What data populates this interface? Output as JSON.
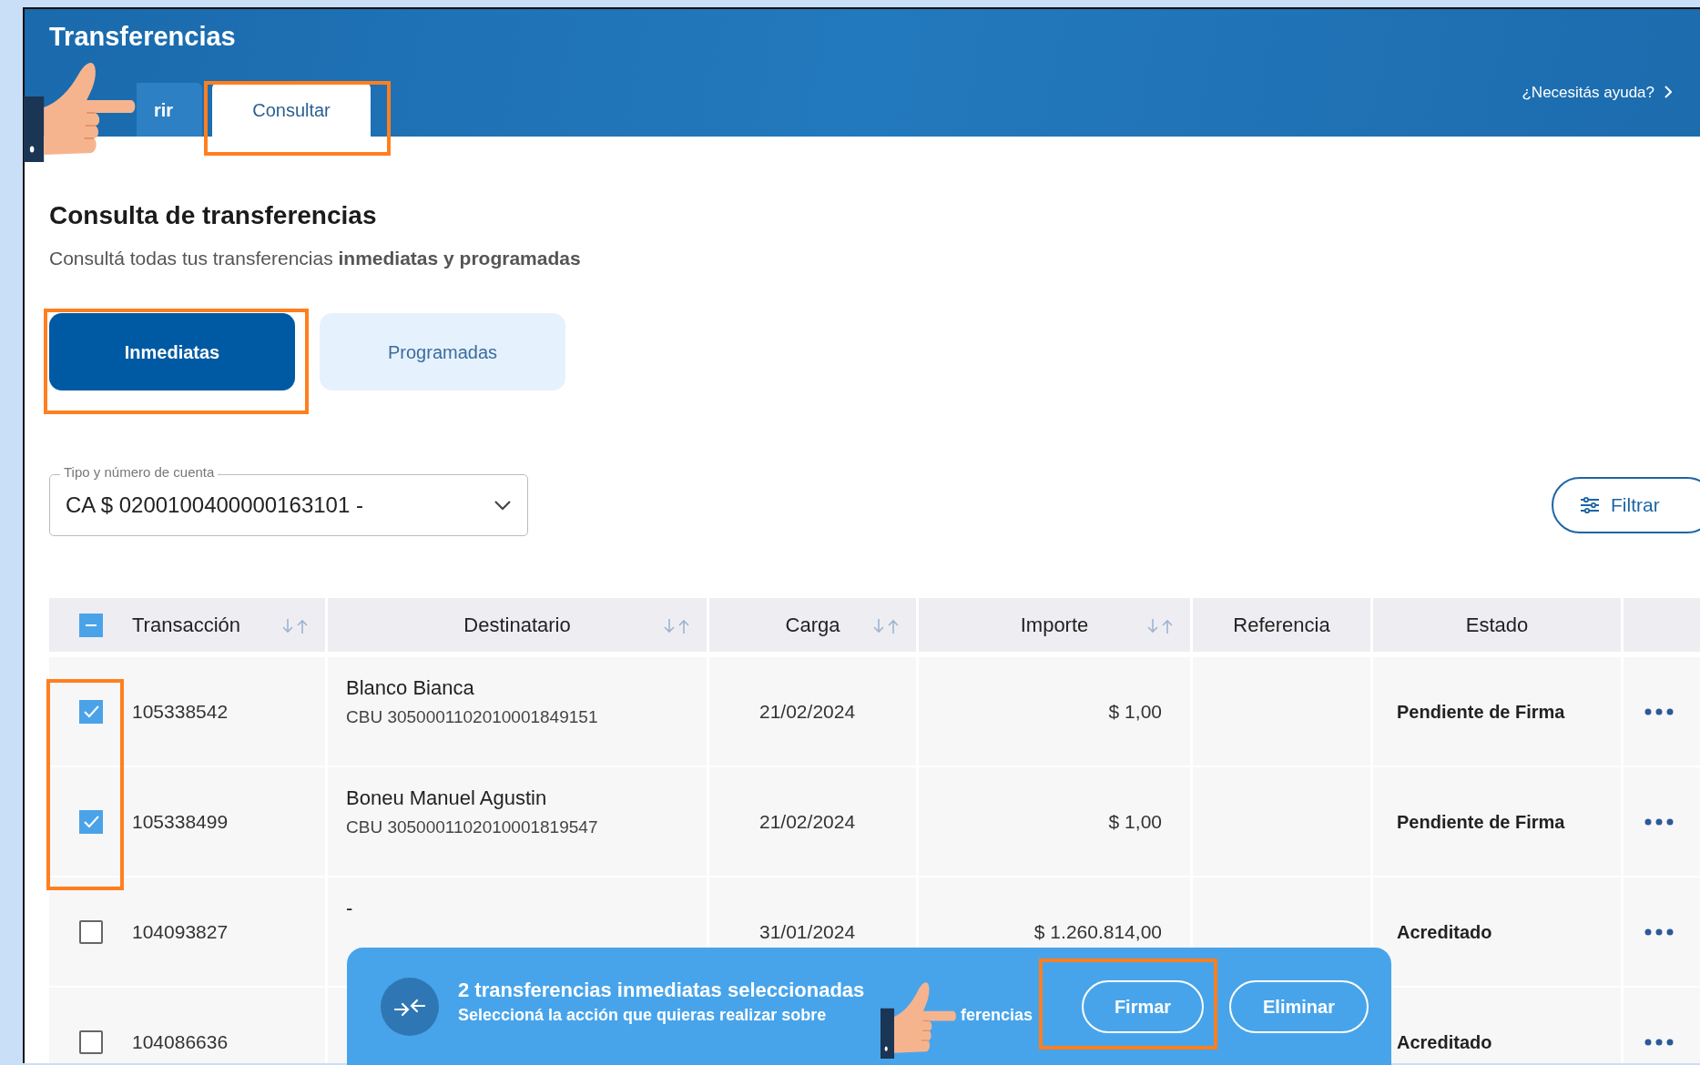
{
  "header": {
    "title": "Transferencias",
    "tabs": [
      {
        "label": "rir",
        "selected": false
      },
      {
        "label": "Consultar",
        "selected": true
      }
    ],
    "help_link": "¿Necesitás ayuda?"
  },
  "heading": "Consulta de transferencias",
  "subtitle": "Consultá todas tus transferencias **inmediatas y programadas**",
  "segments": [
    {
      "label": "Inmediatas",
      "selected": true
    },
    {
      "label": "Programadas",
      "selected": false
    }
  ],
  "account_select": {
    "label": "Tipo y número de cuenta",
    "value": "CA $ 0200100400000163101 -"
  },
  "filter_button": "Filtrar",
  "table": {
    "select_all_indeterminate": true,
    "columns": [
      {
        "label": "Transacción",
        "sortable": true
      },
      {
        "label": "Destinatario",
        "sortable": true
      },
      {
        "label": "Carga",
        "sortable": true
      },
      {
        "label": "Importe",
        "sortable": true
      },
      {
        "label": "Referencia",
        "sortable": false
      },
      {
        "label": "Estado",
        "sortable": false
      }
    ],
    "rows": [
      {
        "selected": true,
        "transaction": "105338542",
        "recipient": "Blanco Bianca",
        "recipient_account": "CBU 3050001102010001849151",
        "date": "21/02/2024",
        "amount": "$ 1,00",
        "status": "Pendiente de Firma"
      },
      {
        "selected": true,
        "transaction": "105338499",
        "recipient": "Boneu Manuel Agustin",
        "recipient_account": "CBU 3050001102010001819547",
        "date": "21/02/2024",
        "amount": "$ 1,00",
        "status": "Pendiente de Firma"
      },
      {
        "selected": false,
        "transaction": "104093827",
        "recipient": "-",
        "date": "31/01/2024",
        "amount": "$ 1.260.814,00",
        "status": "Acreditado"
      },
      {
        "selected": false,
        "transaction": "104086636",
        "status": "Acreditado"
      }
    ]
  },
  "selection_bar": {
    "title": "2 transferencias inmediatas seleccionadas",
    "message_start": "Seleccioná la acción que quieras realizar sobre",
    "message_end": "ferencias",
    "actions": [
      "Firmar",
      "Eliminar"
    ]
  }
}
